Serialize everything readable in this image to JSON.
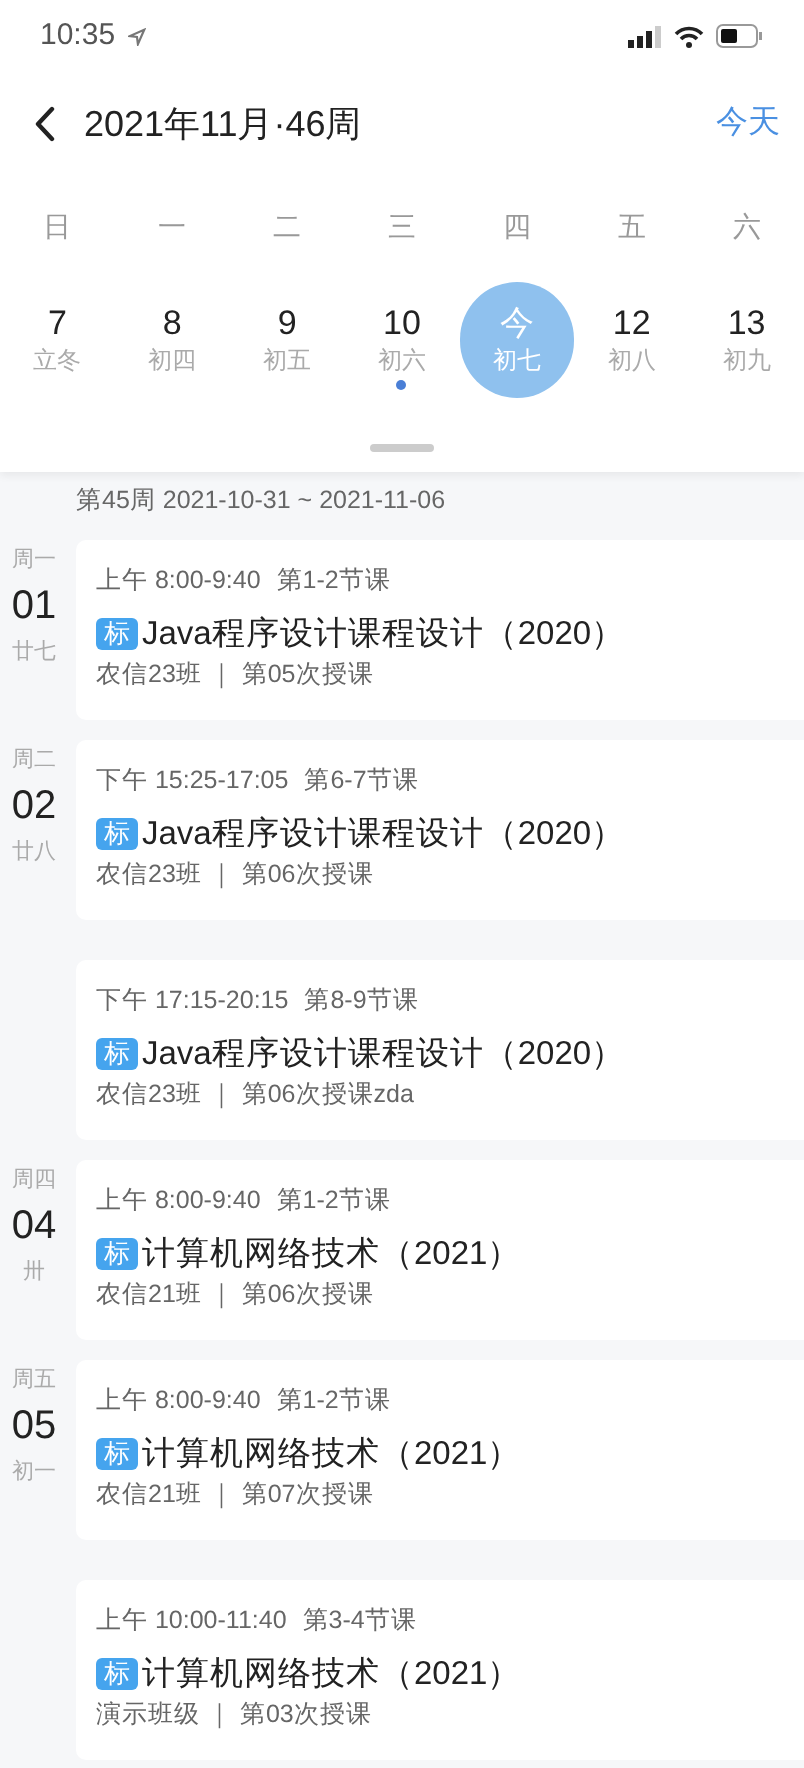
{
  "status_bar": {
    "time": "10:35"
  },
  "header": {
    "title": "2021年11月·46周",
    "today_button": "今天"
  },
  "weekdays": [
    "日",
    "一",
    "二",
    "三",
    "四",
    "五",
    "六"
  ],
  "dates": [
    {
      "day": "7",
      "lunar": "立冬",
      "selected": false,
      "has_event": false
    },
    {
      "day": "8",
      "lunar": "初四",
      "selected": false,
      "has_event": false
    },
    {
      "day": "9",
      "lunar": "初五",
      "selected": false,
      "has_event": false
    },
    {
      "day": "10",
      "lunar": "初六",
      "selected": false,
      "has_event": true
    },
    {
      "day": "今",
      "lunar": "初七",
      "selected": true,
      "has_event": false
    },
    {
      "day": "12",
      "lunar": "初八",
      "selected": false,
      "has_event": false
    },
    {
      "day": "13",
      "lunar": "初九",
      "selected": false,
      "has_event": false
    }
  ],
  "week_label": "第45周 2021-10-31 ~ 2021-11-06",
  "days": [
    {
      "weekday": "周一",
      "date": "01",
      "lunar": "廿七",
      "lessons": [
        {
          "time": "上午 8:00-9:40",
          "periods": "第1-2节课",
          "badge": "标",
          "course": "Java程序设计课程设计（2020）",
          "detail": "农信23班 ｜ 第05次授课"
        }
      ]
    },
    {
      "weekday": "周二",
      "date": "02",
      "lunar": "廿八",
      "lessons": [
        {
          "time": "下午 15:25-17:05",
          "periods": "第6-7节课",
          "badge": "标",
          "course": "Java程序设计课程设计（2020）",
          "detail": "农信23班 ｜ 第06次授课"
        },
        {
          "time": "下午 17:15-20:15",
          "periods": "第8-9节课",
          "badge": "标",
          "course": "Java程序设计课程设计（2020）",
          "detail": "农信23班 ｜ 第06次授课zda"
        }
      ]
    },
    {
      "weekday": "周四",
      "date": "04",
      "lunar": "卅",
      "lessons": [
        {
          "time": "上午 8:00-9:40",
          "periods": "第1-2节课",
          "badge": "标",
          "course": "计算机网络技术（2021）",
          "detail": "农信21班 ｜ 第06次授课"
        }
      ]
    },
    {
      "weekday": "周五",
      "date": "05",
      "lunar": "初一",
      "lessons": [
        {
          "time": "上午 8:00-9:40",
          "periods": "第1-2节课",
          "badge": "标",
          "course": "计算机网络技术（2021）",
          "detail": "农信21班 ｜ 第07次授课"
        },
        {
          "time": "上午 10:00-11:40",
          "periods": "第3-4节课",
          "badge": "标",
          "course": "计算机网络技术（2021）",
          "detail": "演示班级 ｜ 第03次授课"
        }
      ]
    }
  ]
}
